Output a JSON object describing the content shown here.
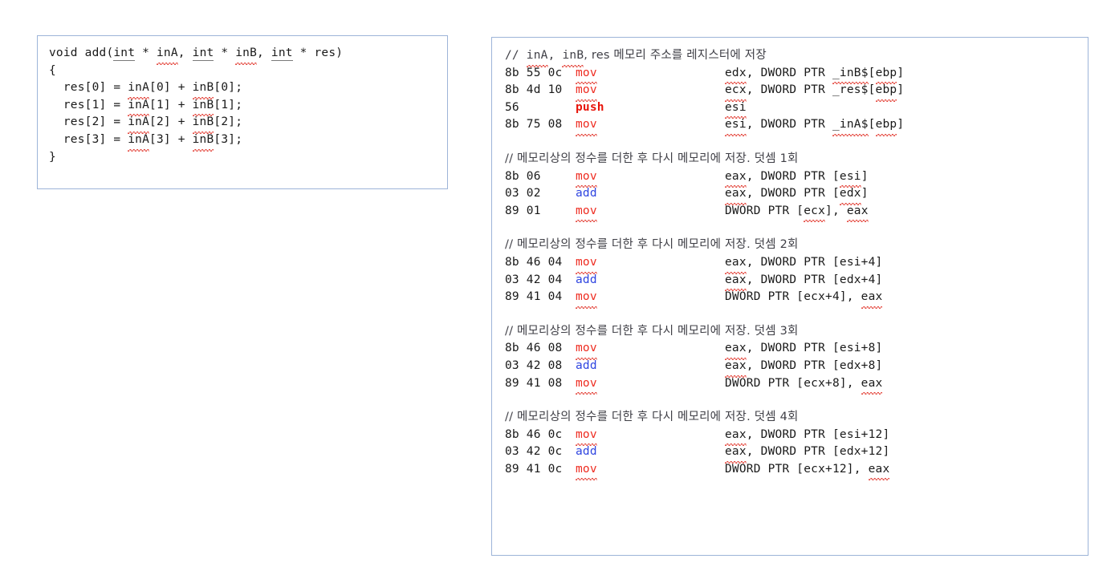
{
  "colors": {
    "panel_border": "#9db4d8",
    "background": "#ffffff",
    "mnemonic_mov": "#ee2b20",
    "mnemonic_push": "#e8140a",
    "mnemonic_add": "#2f45e0",
    "comment_text": "#3f3f46",
    "spellcheck_squiggle": "#e23a30",
    "code_text": "#1a1a1a"
  },
  "c_source": {
    "lines": [
      {
        "id": "sig",
        "parts": [
          {
            "t": "void add(",
            "s": "plain"
          },
          {
            "t": "int",
            "s": "underline"
          },
          {
            "t": " * ",
            "s": "plain"
          },
          {
            "t": "inA",
            "s": "squiggle"
          },
          {
            "t": ", ",
            "s": "plain"
          },
          {
            "t": "int",
            "s": "underline"
          },
          {
            "t": " * ",
            "s": "plain"
          },
          {
            "t": "inB",
            "s": "squiggle"
          },
          {
            "t": ", ",
            "s": "plain"
          },
          {
            "t": "int",
            "s": "underline"
          },
          {
            "t": " * res)",
            "s": "plain"
          }
        ]
      },
      {
        "id": "open",
        "parts": [
          {
            "t": "{",
            "s": "plain"
          }
        ]
      },
      {
        "id": "res0",
        "parts": [
          {
            "t": "  res[0] = ",
            "s": "plain"
          },
          {
            "t": "inA",
            "s": "squiggle"
          },
          {
            "t": "[0] + ",
            "s": "plain"
          },
          {
            "t": "inB",
            "s": "squiggle"
          },
          {
            "t": "[0];",
            "s": "plain"
          }
        ]
      },
      {
        "id": "res1",
        "parts": [
          {
            "t": "  res[1] = ",
            "s": "plain"
          },
          {
            "t": "inA",
            "s": "squiggle"
          },
          {
            "t": "[1] + ",
            "s": "plain"
          },
          {
            "t": "inB",
            "s": "squiggle"
          },
          {
            "t": "[1];",
            "s": "plain"
          }
        ]
      },
      {
        "id": "res2",
        "parts": [
          {
            "t": "  res[2] = ",
            "s": "plain"
          },
          {
            "t": "inA",
            "s": "squiggle"
          },
          {
            "t": "[2] + ",
            "s": "plain"
          },
          {
            "t": "inB",
            "s": "squiggle"
          },
          {
            "t": "[2];",
            "s": "plain"
          }
        ]
      },
      {
        "id": "res3",
        "parts": [
          {
            "t": "  res[3] = ",
            "s": "plain"
          },
          {
            "t": "inA",
            "s": "squiggle"
          },
          {
            "t": "[3] + ",
            "s": "plain"
          },
          {
            "t": "inB",
            "s": "squiggle"
          },
          {
            "t": "[3];",
            "s": "plain"
          }
        ]
      },
      {
        "id": "close",
        "parts": [
          {
            "t": "}",
            "s": "plain"
          }
        ]
      }
    ]
  },
  "assembly": {
    "blocks": [
      {
        "id": "block-store-addresses",
        "comment": [
          {
            "t": "// ",
            "s": "plain"
          },
          {
            "t": "inA",
            "s": "squiggle"
          },
          {
            "t": ", ",
            "s": "plain"
          },
          {
            "t": "inB",
            "s": "squiggle"
          },
          {
            "t": ", res 메모리 주소를 레지스터에 저장",
            "s": "plain"
          }
        ],
        "rows": [
          {
            "bytes": "8b 55 0c",
            "mnemonic": "mov",
            "mn_style": "mov",
            "operands": [
              {
                "t": "edx",
                "s": "squiggle"
              },
              {
                "t": ", DWORD PTR ",
                "s": "plain"
              },
              {
                "t": "_inB$",
                "s": "squiggle"
              },
              {
                "t": "[",
                "s": "plain"
              },
              {
                "t": "ebp",
                "s": "squiggle"
              },
              {
                "t": "]",
                "s": "plain"
              }
            ]
          },
          {
            "bytes": "8b 4d 10",
            "mnemonic": "mov",
            "mn_style": "mov",
            "operands": [
              {
                "t": "ecx",
                "s": "squiggle"
              },
              {
                "t": ", DWORD PTR _res$",
                "s": "plain"
              },
              {
                "t": "[",
                "s": "plain"
              },
              {
                "t": "ebp",
                "s": "squiggle"
              },
              {
                "t": "]",
                "s": "plain"
              }
            ]
          },
          {
            "bytes": "56",
            "mnemonic": "push",
            "mn_style": "push",
            "operands": [
              {
                "t": "esi",
                "s": "squiggle"
              }
            ]
          },
          {
            "bytes": "8b 75 08",
            "mnemonic": "mov",
            "mn_style": "mov",
            "operands": [
              {
                "t": "esi",
                "s": "squiggle"
              },
              {
                "t": ", DWORD PTR ",
                "s": "plain"
              },
              {
                "t": "_inA$",
                "s": "squiggle"
              },
              {
                "t": "[",
                "s": "plain"
              },
              {
                "t": "ebp",
                "s": "squiggle"
              },
              {
                "t": "]",
                "s": "plain"
              }
            ]
          }
        ]
      },
      {
        "id": "block-add-1",
        "comment": [
          {
            "t": "// 메모리상의 정수를 더한 후 다시 메모리에 저장. 덧셈 1회",
            "s": "plain"
          }
        ],
        "rows": [
          {
            "bytes": "8b 06",
            "mnemonic": "mov",
            "mn_style": "mov",
            "operands": [
              {
                "t": "eax",
                "s": "squiggle"
              },
              {
                "t": ", DWORD PTR [",
                "s": "plain"
              },
              {
                "t": "esi",
                "s": "squiggle"
              },
              {
                "t": "]",
                "s": "plain"
              }
            ]
          },
          {
            "bytes": "03 02",
            "mnemonic": "add",
            "mn_style": "add",
            "operands": [
              {
                "t": "eax",
                "s": "squiggle"
              },
              {
                "t": ", DWORD PTR [",
                "s": "plain"
              },
              {
                "t": "edx",
                "s": "squiggle"
              },
              {
                "t": "]",
                "s": "plain"
              }
            ]
          },
          {
            "bytes": "89 01",
            "mnemonic": "mov",
            "mn_style": "mov",
            "operands": [
              {
                "t": "DWORD PTR [",
                "s": "plain"
              },
              {
                "t": "ecx",
                "s": "squiggle"
              },
              {
                "t": "], ",
                "s": "plain"
              },
              {
                "t": "eax",
                "s": "squiggle"
              }
            ]
          }
        ]
      },
      {
        "id": "block-add-2",
        "comment": [
          {
            "t": "// 메모리상의 정수를 더한 후 다시 메모리에 저장. 덧셈 2회",
            "s": "plain"
          }
        ],
        "rows": [
          {
            "bytes": "8b 46 04",
            "mnemonic": "mov",
            "mn_style": "mov",
            "operands": [
              {
                "t": "eax",
                "s": "squiggle"
              },
              {
                "t": ", DWORD PTR [esi+4]",
                "s": "plain"
              }
            ]
          },
          {
            "bytes": "03 42 04",
            "mnemonic": "add",
            "mn_style": "add",
            "operands": [
              {
                "t": "eax",
                "s": "squiggle"
              },
              {
                "t": ", DWORD PTR [edx+4]",
                "s": "plain"
              }
            ]
          },
          {
            "bytes": "89 41 04",
            "mnemonic": "mov",
            "mn_style": "mov",
            "operands": [
              {
                "t": "DWORD PTR [ecx+4], ",
                "s": "plain"
              },
              {
                "t": "eax",
                "s": "squiggle"
              }
            ]
          }
        ]
      },
      {
        "id": "block-add-3",
        "comment": [
          {
            "t": "// 메모리상의 정수를 더한 후 다시 메모리에 저장. 덧셈 3회",
            "s": "plain"
          }
        ],
        "rows": [
          {
            "bytes": "8b 46 08",
            "mnemonic": "mov",
            "mn_style": "mov",
            "operands": [
              {
                "t": "eax",
                "s": "squiggle"
              },
              {
                "t": ", DWORD PTR [esi+8]",
                "s": "plain"
              }
            ]
          },
          {
            "bytes": "03 42 08",
            "mnemonic": "add",
            "mn_style": "add",
            "operands": [
              {
                "t": "eax",
                "s": "squiggle"
              },
              {
                "t": ", DWORD PTR [edx+8]",
                "s": "plain"
              }
            ]
          },
          {
            "bytes": "89 41 08",
            "mnemonic": "mov",
            "mn_style": "mov",
            "operands": [
              {
                "t": "DWORD PTR [ecx+8], ",
                "s": "plain"
              },
              {
                "t": "eax",
                "s": "squiggle"
              }
            ]
          }
        ]
      },
      {
        "id": "block-add-4",
        "comment": [
          {
            "t": "// 메모리상의 정수를 더한 후 다시 메모리에 저장. 덧셈 4회",
            "s": "plain"
          }
        ],
        "rows": [
          {
            "bytes": "8b 46 0c",
            "mnemonic": "mov",
            "mn_style": "mov",
            "operands": [
              {
                "t": "eax",
                "s": "squiggle"
              },
              {
                "t": ", DWORD PTR [esi+12]",
                "s": "plain"
              }
            ]
          },
          {
            "bytes": "03 42 0c",
            "mnemonic": "add",
            "mn_style": "add",
            "operands": [
              {
                "t": "eax",
                "s": "squiggle"
              },
              {
                "t": ", DWORD PTR [edx+12]",
                "s": "plain"
              }
            ]
          },
          {
            "bytes": "89 41 0c",
            "mnemonic": "mov",
            "mn_style": "mov",
            "operands": [
              {
                "t": "DWORD PTR [ecx+12], ",
                "s": "plain"
              },
              {
                "t": "eax",
                "s": "squiggle"
              }
            ]
          }
        ]
      }
    ]
  }
}
